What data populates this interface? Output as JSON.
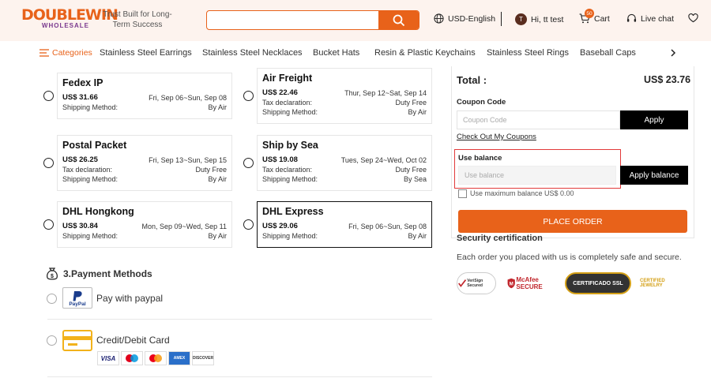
{
  "header": {
    "logo_line1": "DOUBLEWIN",
    "logo_line2": "WHOLESALE",
    "tagline": "Trust Built for Long-Term Success",
    "search_placeholder": "",
    "currency": "USD-English",
    "avatar_letter": "T",
    "greeting": "Hi, tt test",
    "cart_count": "50",
    "cart_label": "Cart",
    "live_chat": "Live chat"
  },
  "nav": {
    "categories_label": "Categories",
    "items": [
      "Stainless Steel Earrings",
      "Stainless Steel Necklaces",
      "Bucket Hats",
      "Resin & Plastic Keychains",
      "Stainless Steel Rings",
      "Baseball Caps"
    ]
  },
  "shipping": [
    {
      "name": "Fedex IP",
      "price": "US$ 31.66",
      "dates": "Fri, Sep 06~Sun, Sep 08",
      "tax_label": "",
      "tax_value": "",
      "method_label": "Shipping Method:",
      "method": "By Air",
      "selected": false
    },
    {
      "name": "Air Freight",
      "price": "US$ 22.46",
      "dates": "Thur, Sep 12~Sat, Sep 14",
      "tax_label": "Tax declaration:",
      "tax_value": "Duty Free",
      "method_label": "Shipping Method:",
      "method": "By Air",
      "selected": false
    },
    {
      "name": "Postal Packet",
      "price": "US$ 26.25",
      "dates": "Fri, Sep 13~Sun, Sep 15",
      "tax_label": "Tax declaration:",
      "tax_value": "Duty Free",
      "method_label": "Shipping Method:",
      "method": "By Air",
      "selected": false
    },
    {
      "name": "Ship by Sea",
      "price": "US$ 19.08",
      "dates": "Tues, Sep 24~Wed, Oct 02",
      "tax_label": "Tax declaration:",
      "tax_value": "Duty Free",
      "method_label": "Shipping Method:",
      "method": "By Sea",
      "selected": false
    },
    {
      "name": "DHL Hongkong",
      "price": "US$ 30.84",
      "dates": "Mon, Sep 09~Wed, Sep 11",
      "tax_label": "",
      "tax_value": "",
      "method_label": "Shipping Method:",
      "method": "By Air",
      "selected": false
    },
    {
      "name": "DHL Express",
      "price": "US$ 29.06",
      "dates": "Fri, Sep 06~Sun, Sep 08",
      "tax_label": "",
      "tax_value": "",
      "method_label": "Shipping Method:",
      "method": "By Air",
      "selected": true
    }
  ],
  "payment": {
    "title": "3.Payment Methods",
    "paypal_label": "Pay with paypal",
    "paypal_logo": "PayPal",
    "card_label": "Credit/Debit Card",
    "card_brands": [
      "VISA",
      "Maestro",
      "Mastercard",
      "AMEX",
      "DISCOVER"
    ]
  },
  "summary": {
    "total_label": "Total :",
    "total_value": "US$ 23.76",
    "coupon_label": "Coupon Code",
    "coupon_placeholder": "Coupon Code",
    "apply_label": "Apply",
    "check_coupons": "Check Out My Coupons",
    "balance_label": "Use balance",
    "balance_placeholder": "Use balance",
    "apply_balance_label": "Apply balance",
    "max_balance_label": "Use maximum balance US$ 0.00",
    "place_order": "PLACE ORDER",
    "security_title": "Security certification",
    "security_text": "Each order you placed with us is completely safe and secure.",
    "badges": [
      "VeriSign Secured",
      "McAfee SECURE",
      "CERTIFICADO SSL",
      "CERTIFIED JEWELRY"
    ]
  },
  "colors": {
    "accent": "#e8621a",
    "highlight_box": "#e23a3a",
    "header_bg": "#fdf3ee"
  }
}
